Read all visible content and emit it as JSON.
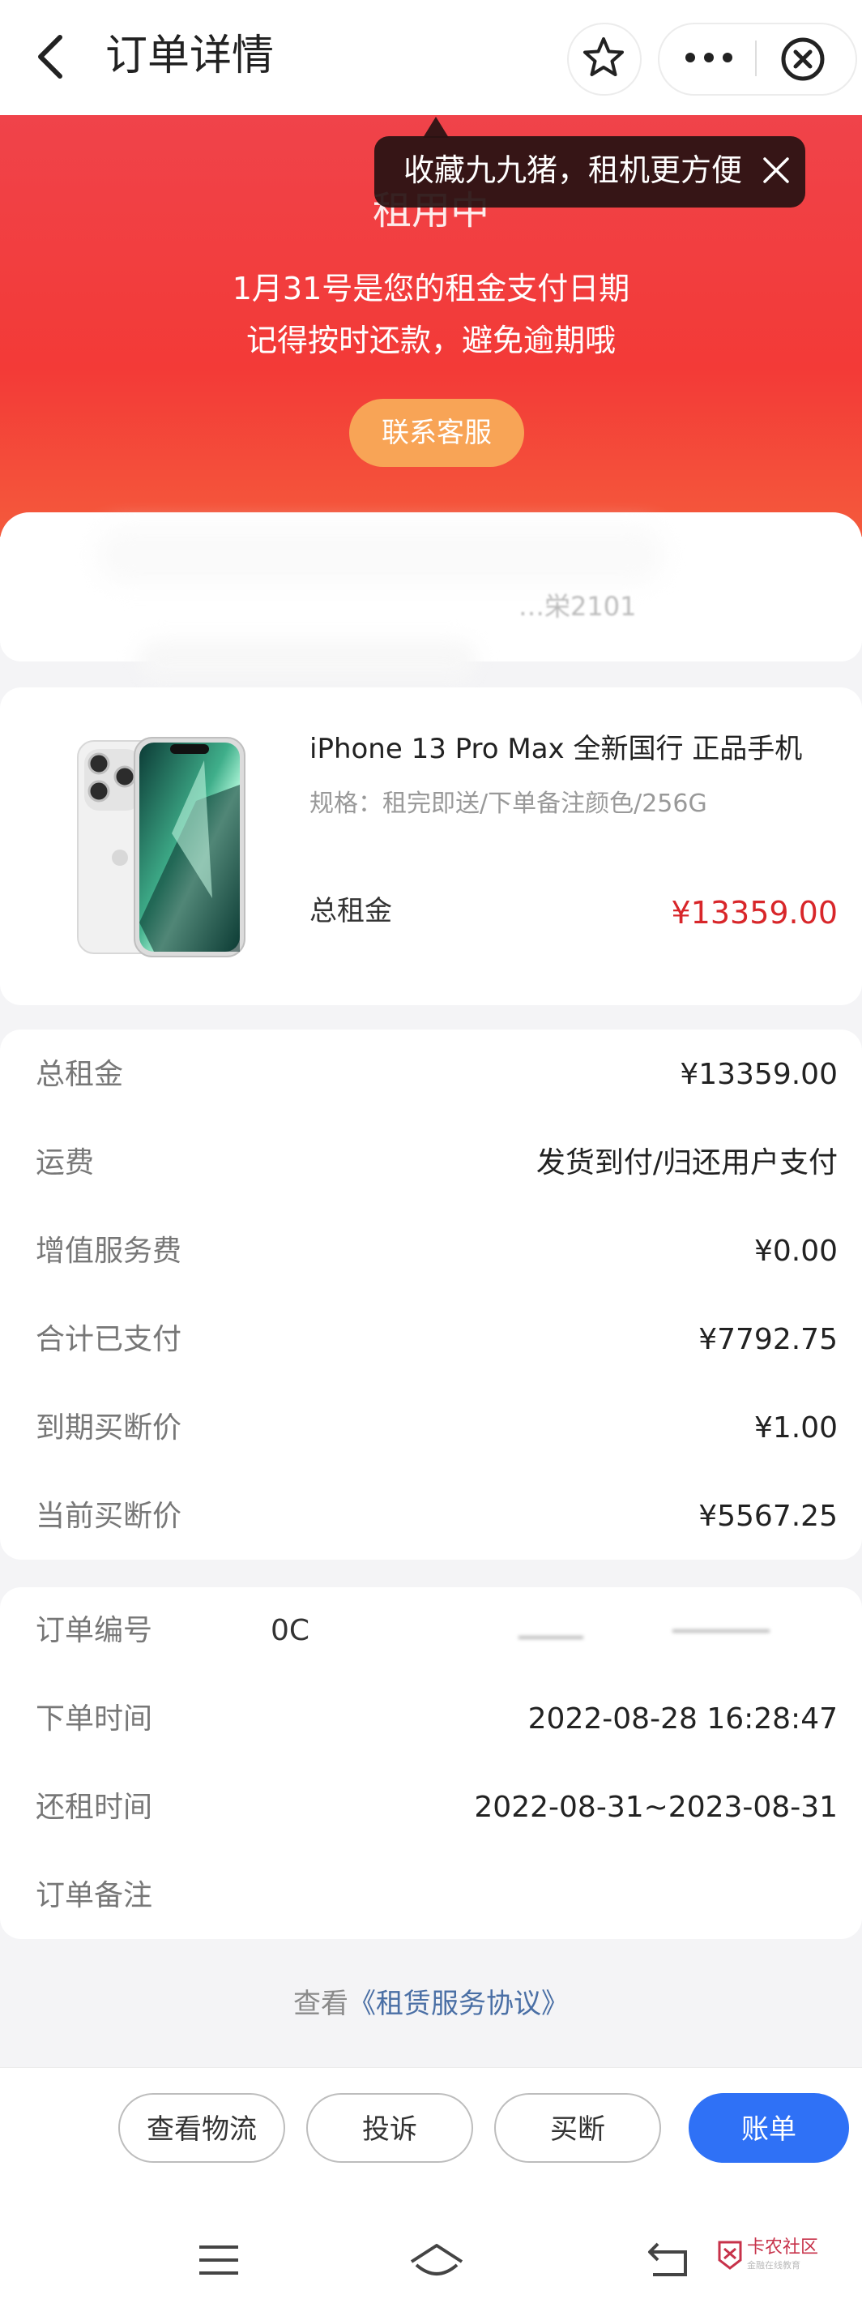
{
  "nav": {
    "title": "订单详情",
    "back_icon": "chevron-left-icon",
    "favorite_icon": "star-icon",
    "more_icon": "more-dots-icon",
    "close_icon": "close-circle-icon"
  },
  "tooltip": {
    "text": "收藏九九猪，租机更方便",
    "close_icon": "close-icon"
  },
  "status": {
    "title": "租用中",
    "due_line": "1月31号是您的租金支付日期",
    "reminder_line": "记得按时还款，避免逾期哦",
    "contact_button": "联系客服",
    "accent_color": "#f33a37"
  },
  "address": {
    "text": "…栄2101"
  },
  "product": {
    "name": "iPhone 13 Pro Max 全新国行 正品手机",
    "spec": "规格：租完即送/下单备注颜色/256G",
    "total_label": "总租金",
    "total_value": "¥13359.00",
    "price_color": "#d8262a"
  },
  "fees": [
    {
      "label": "总租金",
      "value": "¥13359.00"
    },
    {
      "label": "运费",
      "value": "发货到付/归还用户支付"
    },
    {
      "label": "增值服务费",
      "value": "¥0.00"
    },
    {
      "label": "合计已支付",
      "value": "¥7792.75"
    },
    {
      "label": "到期买断价",
      "value": "¥1.00"
    },
    {
      "label": "当前买断价",
      "value": "¥5567.25"
    }
  ],
  "order_info": {
    "order_no_label": "订单编号",
    "order_no_value": "0C",
    "order_time_label": "下单时间",
    "order_time_value": "2022-08-28 16:28:47",
    "rent_period_label": "还租时间",
    "rent_period_value": "2022-08-31~2023-08-31",
    "remark_label": "订单备注"
  },
  "agreement": {
    "prefix": "查看",
    "link": "《租赁服务协议》"
  },
  "actions": {
    "logistics": "查看物流",
    "complaint": "投诉",
    "buyout": "买断",
    "bill": "账单",
    "primary_color": "#2f71f6"
  },
  "system_bar": {
    "menu_icon": "menu-icon",
    "home_icon": "home-icon",
    "back_icon": "back-arrow-icon"
  },
  "watermark": {
    "text": "卡农社区",
    "sub": "金融在线教育"
  }
}
